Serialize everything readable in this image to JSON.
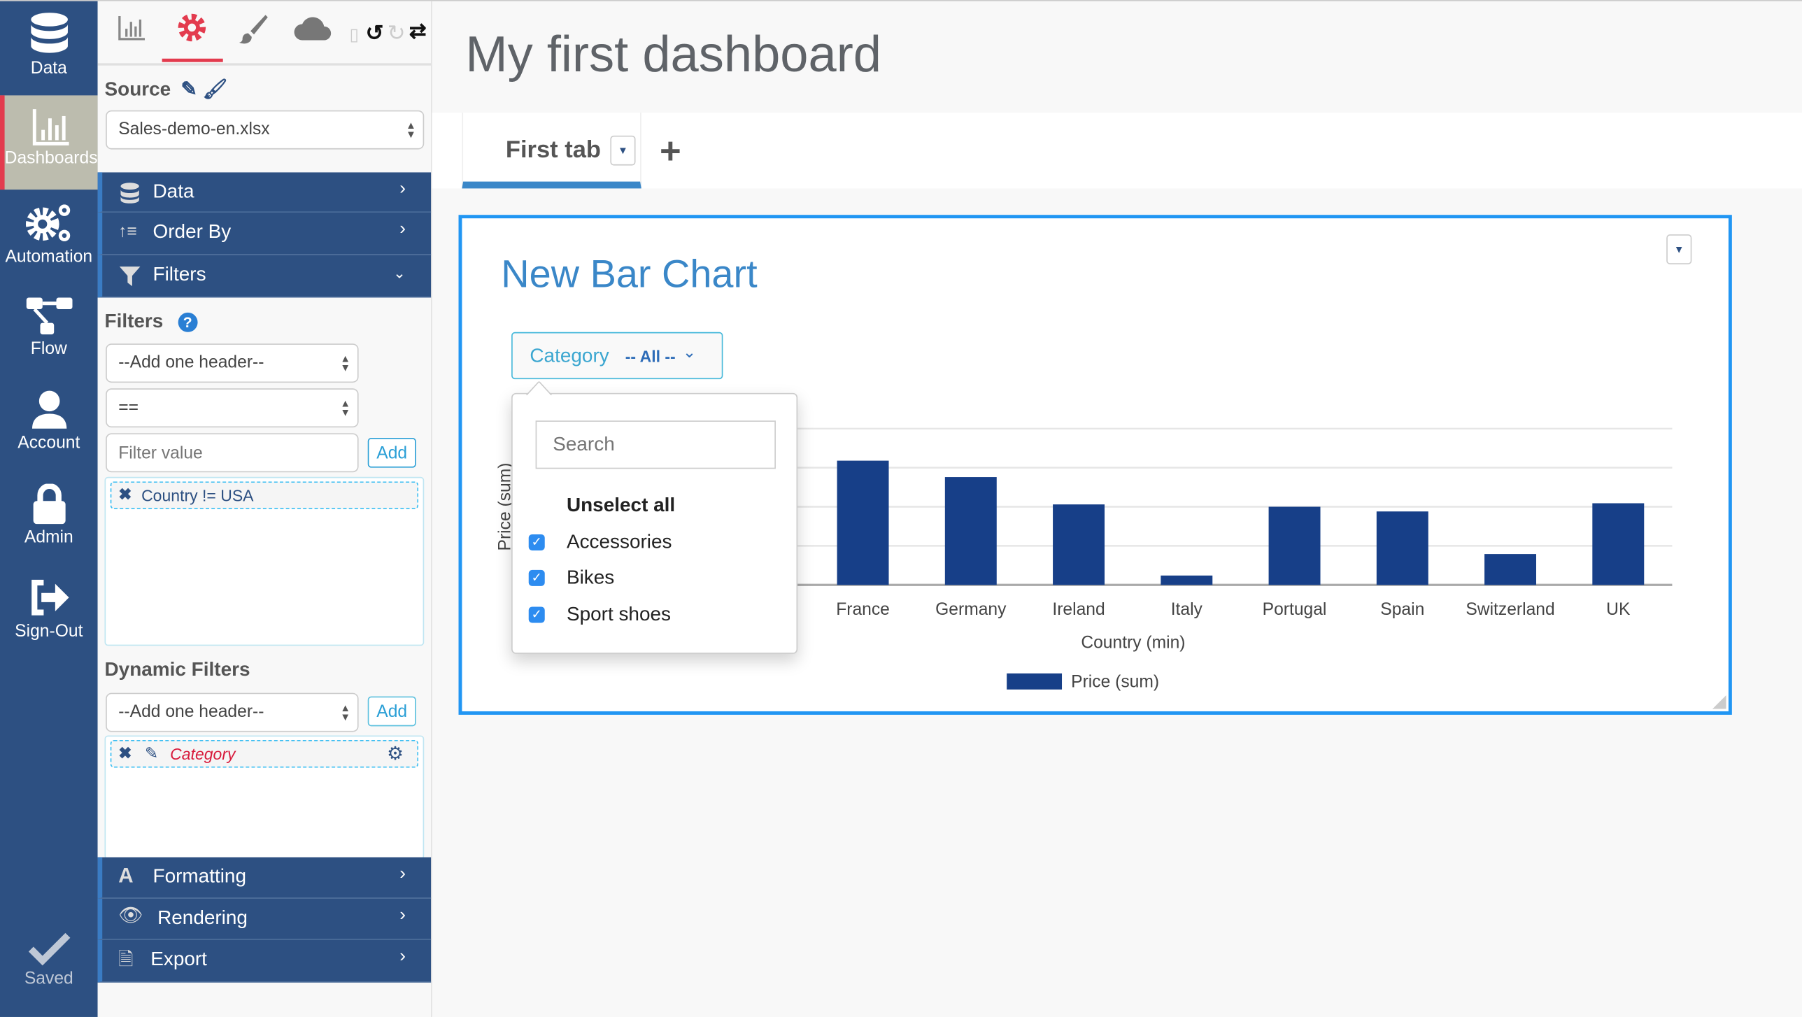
{
  "nav": {
    "items": [
      {
        "label": "Data",
        "icon": "database-icon"
      },
      {
        "label": "Dashboards",
        "icon": "bar-chart-icon",
        "active": true
      },
      {
        "label": "Automation",
        "icon": "gears-icon"
      },
      {
        "label": "Flow",
        "icon": "sitemap-icon"
      },
      {
        "label": "Account",
        "icon": "user-icon"
      },
      {
        "label": "Admin",
        "icon": "lock-icon"
      },
      {
        "label": "Sign-Out",
        "icon": "sign-out-icon"
      }
    ],
    "saved_label": "Saved"
  },
  "panel": {
    "source_label": "Source",
    "source_value": "Sales-demo-en.xlsx",
    "accordion_top": [
      {
        "label": "Data"
      },
      {
        "label": "Order By"
      },
      {
        "label": "Filters"
      }
    ],
    "filters": {
      "heading": "Filters",
      "header_select": "--Add one header--",
      "operator_select": "==",
      "value_placeholder": "Filter value",
      "add_label": "Add",
      "active": [
        "Country != USA"
      ]
    },
    "dynamic_filters": {
      "heading": "Dynamic Filters",
      "header_select": "--Add one header--",
      "add_label": "Add",
      "active": [
        "Category"
      ]
    },
    "accordion_bottom": [
      {
        "label": "Formatting"
      },
      {
        "label": "Rendering"
      },
      {
        "label": "Export"
      }
    ]
  },
  "colors": {
    "nav": "#2d5082",
    "accent": "#2196f3",
    "bar": "#173f88",
    "active_tool": "#e33b4e",
    "dynamic_filter": "#d81b3c"
  },
  "main": {
    "title": "My first dashboard",
    "tabs": [
      {
        "label": "First tab",
        "active": true
      }
    ],
    "add_tab": "+"
  },
  "widget": {
    "title": "New Bar Chart",
    "filter": {
      "label": "Category",
      "value": "-- All --"
    },
    "dropdown": {
      "search_placeholder": "Search",
      "unselect_all": "Unselect all",
      "options": [
        {
          "label": "Accessories",
          "checked": true
        },
        {
          "label": "Bikes",
          "checked": true
        },
        {
          "label": "Sport shoes",
          "checked": true
        }
      ]
    }
  },
  "chart_data": {
    "type": "bar",
    "title": "New Bar Chart",
    "categories": [
      "France",
      "Germany",
      "Ireland",
      "Italy",
      "Portugal",
      "Spain",
      "Switzerland",
      "UK"
    ],
    "series": [
      {
        "name": "Price (sum)",
        "values": [
          3.18,
          2.76,
          2.06,
          0.24,
          2.0,
          1.88,
          0.79,
          2.09
        ]
      }
    ],
    "xlabel": "Country (min)",
    "ylabel": "Price (sum)",
    "ylim": [
      0,
      4
    ],
    "grid": true,
    "legend": "bottom"
  }
}
